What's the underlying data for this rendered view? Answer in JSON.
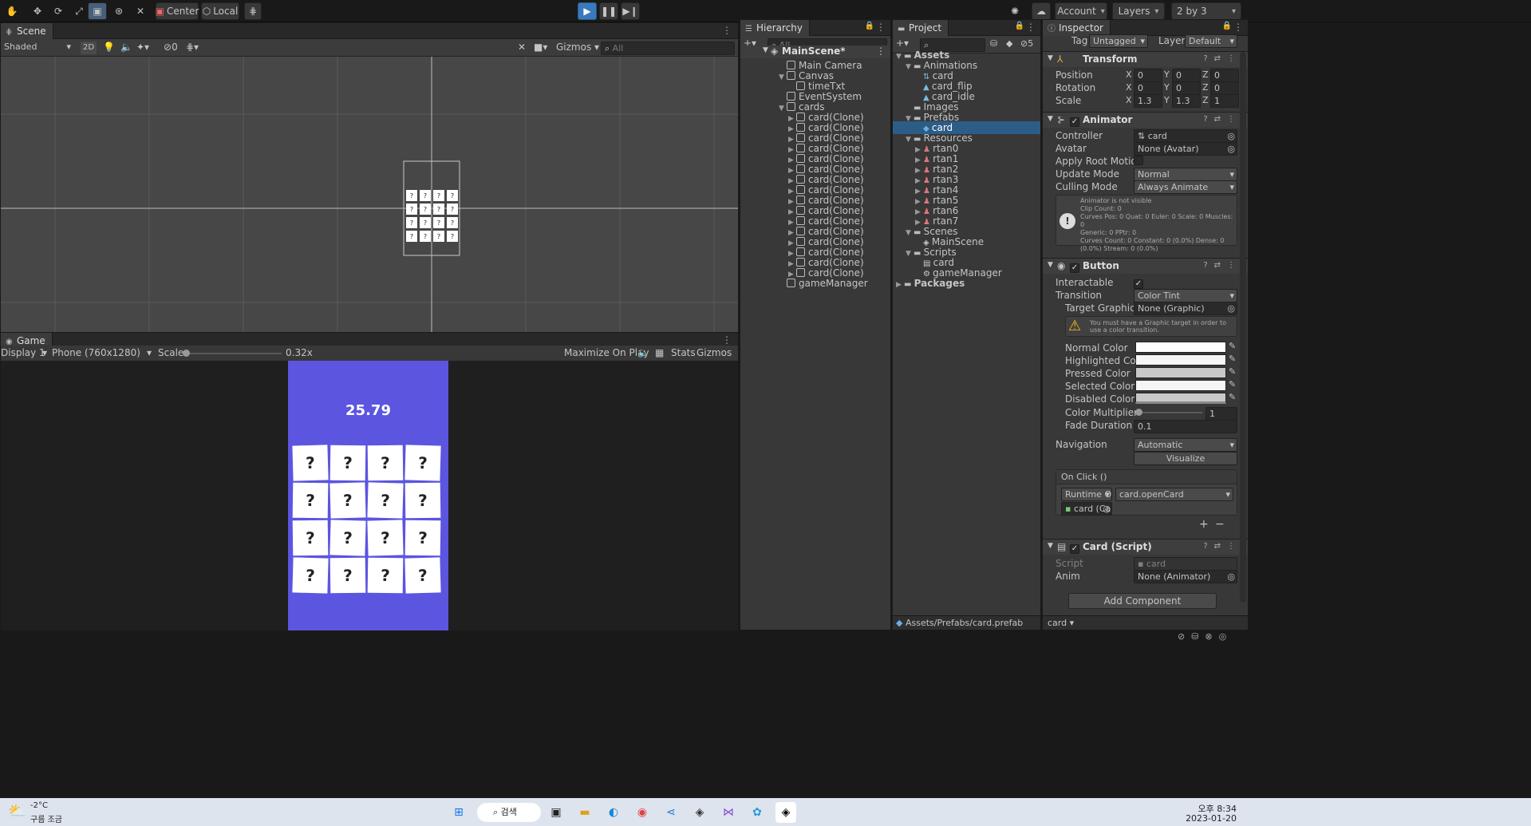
{
  "toolbar": {
    "center_label": "Center",
    "local_label": "Local",
    "account_label": "Account",
    "layers_label": "Layers",
    "layout_label": "2 by 3"
  },
  "scene": {
    "tab_label": "Scene",
    "shading": "Shaded",
    "mode_2d": "2D",
    "hidden_count": "0",
    "gizmos_label": "Gizmos",
    "search_placeholder": "All"
  },
  "game": {
    "tab_label": "Game",
    "display": "Display 1",
    "resolution": "Phone (760x1280)",
    "scale_label": "Scale",
    "scale_value": "0.32x",
    "maximize_label": "Maximize On Play",
    "stats_label": "Stats",
    "gizmos_label": "Gizmos",
    "timer": "25.79",
    "card_text": "?"
  },
  "hierarchy": {
    "tab_label": "Hierarchy",
    "search_placeholder": "All",
    "scene_name": "MainScene*",
    "items": [
      {
        "label": "Main Camera",
        "depth": 1,
        "arrow": ""
      },
      {
        "label": "Canvas",
        "depth": 1,
        "arrow": "▼"
      },
      {
        "label": "timeTxt",
        "depth": 2,
        "arrow": ""
      },
      {
        "label": "EventSystem",
        "depth": 1,
        "arrow": ""
      },
      {
        "label": "cards",
        "depth": 1,
        "arrow": "▼"
      },
      {
        "label": "card(Clone)",
        "depth": 2,
        "arrow": "▶"
      },
      {
        "label": "card(Clone)",
        "depth": 2,
        "arrow": "▶"
      },
      {
        "label": "card(Clone)",
        "depth": 2,
        "arrow": "▶"
      },
      {
        "label": "card(Clone)",
        "depth": 2,
        "arrow": "▶"
      },
      {
        "label": "card(Clone)",
        "depth": 2,
        "arrow": "▶"
      },
      {
        "label": "card(Clone)",
        "depth": 2,
        "arrow": "▶"
      },
      {
        "label": "card(Clone)",
        "depth": 2,
        "arrow": "▶"
      },
      {
        "label": "card(Clone)",
        "depth": 2,
        "arrow": "▶"
      },
      {
        "label": "card(Clone)",
        "depth": 2,
        "arrow": "▶"
      },
      {
        "label": "card(Clone)",
        "depth": 2,
        "arrow": "▶"
      },
      {
        "label": "card(Clone)",
        "depth": 2,
        "arrow": "▶"
      },
      {
        "label": "card(Clone)",
        "depth": 2,
        "arrow": "▶"
      },
      {
        "label": "card(Clone)",
        "depth": 2,
        "arrow": "▶"
      },
      {
        "label": "card(Clone)",
        "depth": 2,
        "arrow": "▶"
      },
      {
        "label": "card(Clone)",
        "depth": 2,
        "arrow": "▶"
      },
      {
        "label": "card(Clone)",
        "depth": 2,
        "arrow": "▶"
      },
      {
        "label": "gameManager",
        "depth": 1,
        "arrow": ""
      }
    ]
  },
  "project": {
    "tab_label": "Project",
    "hidden_count": "5",
    "path": "Assets/Prefabs/card.prefab",
    "items": [
      {
        "label": "Assets",
        "depth": 0,
        "arrow": "▼",
        "icon": "folder",
        "bold": true
      },
      {
        "label": "Animations",
        "depth": 1,
        "arrow": "▼",
        "icon": "folder"
      },
      {
        "label": "card",
        "depth": 2,
        "arrow": "",
        "icon": "anim"
      },
      {
        "label": "card_flip",
        "depth": 2,
        "arrow": "",
        "icon": "clip"
      },
      {
        "label": "card_idle",
        "depth": 2,
        "arrow": "",
        "icon": "clip"
      },
      {
        "label": "Images",
        "depth": 1,
        "arrow": "",
        "icon": "folder"
      },
      {
        "label": "Prefabs",
        "depth": 1,
        "arrow": "▼",
        "icon": "folder"
      },
      {
        "label": "card",
        "depth": 2,
        "arrow": "",
        "icon": "prefab",
        "selected": true
      },
      {
        "label": "Resources",
        "depth": 1,
        "arrow": "▼",
        "icon": "folder"
      },
      {
        "label": "rtan0",
        "depth": 2,
        "arrow": "▶",
        "icon": "sprite"
      },
      {
        "label": "rtan1",
        "depth": 2,
        "arrow": "▶",
        "icon": "sprite"
      },
      {
        "label": "rtan2",
        "depth": 2,
        "arrow": "▶",
        "icon": "sprite"
      },
      {
        "label": "rtan3",
        "depth": 2,
        "arrow": "▶",
        "icon": "sprite"
      },
      {
        "label": "rtan4",
        "depth": 2,
        "arrow": "▶",
        "icon": "sprite"
      },
      {
        "label": "rtan5",
        "depth": 2,
        "arrow": "▶",
        "icon": "sprite"
      },
      {
        "label": "rtan6",
        "depth": 2,
        "arrow": "▶",
        "icon": "sprite"
      },
      {
        "label": "rtan7",
        "depth": 2,
        "arrow": "▶",
        "icon": "sprite"
      },
      {
        "label": "Scenes",
        "depth": 1,
        "arrow": "▼",
        "icon": "folder"
      },
      {
        "label": "MainScene",
        "depth": 2,
        "arrow": "",
        "icon": "scene"
      },
      {
        "label": "Scripts",
        "depth": 1,
        "arrow": "▼",
        "icon": "folder"
      },
      {
        "label": "card",
        "depth": 2,
        "arrow": "",
        "icon": "script"
      },
      {
        "label": "gameManager",
        "depth": 2,
        "arrow": "",
        "icon": "gear"
      },
      {
        "label": "Packages",
        "depth": 0,
        "arrow": "▶",
        "icon": "folder",
        "bold": true
      }
    ]
  },
  "inspector": {
    "tab_label": "Inspector",
    "tag_label": "Tag",
    "tag_value": "Untagged",
    "layer_label": "Layer",
    "layer_value": "Default",
    "transform": {
      "title": "Transform",
      "position_label": "Position",
      "rotation_label": "Rotation",
      "scale_label": "Scale",
      "position": [
        "0",
        "0",
        "0"
      ],
      "rotation": [
        "0",
        "0",
        "0"
      ],
      "scale": [
        "1.3",
        "1.3",
        "1"
      ]
    },
    "animator": {
      "title": "Animator",
      "controller_label": "Controller",
      "controller_value": "card",
      "avatar_label": "Avatar",
      "avatar_value": "None (Avatar)",
      "apply_root_label": "Apply Root Motion",
      "update_mode_label": "Update Mode",
      "update_mode_value": "Normal",
      "culling_label": "Culling Mode",
      "culling_value": "Always Animate",
      "info": [
        "Animator is not visible",
        "Clip Count: 0",
        "Curves Pos: 0 Quat: 0 Euler: 0 Scale: 0 Muscles: 0",
        "Generic: 0 PPtr: 0",
        "Curves Count: 0 Constant: 0 (0.0%) Dense: 0",
        "(0.0%) Stream: 0 (0.0%)"
      ]
    },
    "button": {
      "title": "Button",
      "interactable_label": "Interactable",
      "transition_label": "Transition",
      "transition_value": "Color Tint",
      "target_label": "Target Graphic",
      "target_value": "None (Graphic)",
      "warning": "You must have a Graphic target in order to use a color transition.",
      "normal_label": "Normal Color",
      "highlighted_label": "Highlighted Color",
      "pressed_label": "Pressed Color",
      "selected_label": "Selected Color",
      "disabled_label": "Disabled Color",
      "multiplier_label": "Color Multiplier",
      "multiplier_value": "1",
      "fade_label": "Fade Duration",
      "fade_value": "0.1",
      "navigation_label": "Navigation",
      "navigation_value": "Automatic",
      "visualize_label": "Visualize",
      "onclick_label": "On Click ()",
      "runtime_value": "Runtime Or",
      "function_value": "card.openCard",
      "object_value": "card (Ca"
    },
    "card_script": {
      "title": "Card (Script)",
      "script_label": "Script",
      "script_value": "card",
      "anim_label": "Anim",
      "anim_value": "None (Animator)"
    },
    "add_component": "Add Component",
    "footer_label": "card"
  },
  "taskbar": {
    "temp": "-2°C",
    "weather": "구름 조금",
    "search_label": "검색",
    "time": "오후 8:34",
    "date": "2023-01-20"
  },
  "colors": {
    "game_bg": "#5b55e0",
    "selection": "#2c5d87",
    "play_btn": "#3a79bb"
  }
}
